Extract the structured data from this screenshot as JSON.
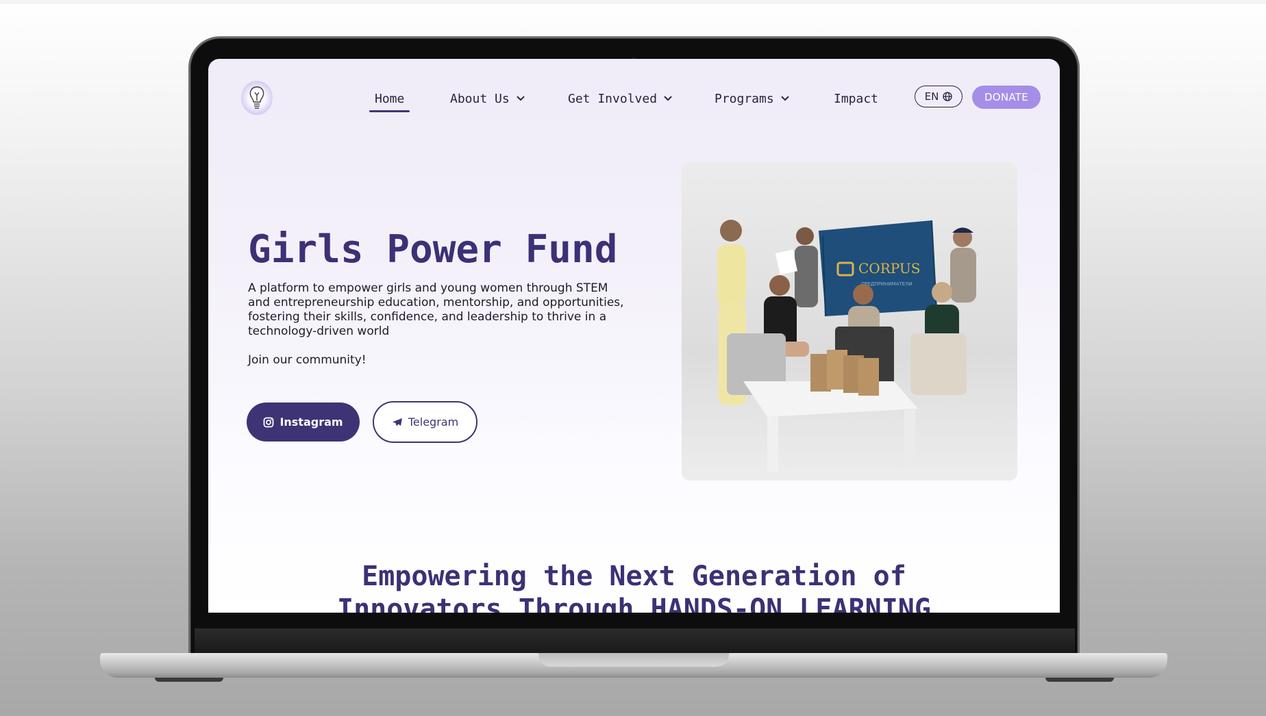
{
  "nav": {
    "items": [
      {
        "label": "Home",
        "has_dropdown": false,
        "active": true
      },
      {
        "label": "About Us",
        "has_dropdown": true
      },
      {
        "label": "Get Involved",
        "has_dropdown": true
      },
      {
        "label": "Programs",
        "has_dropdown": true
      },
      {
        "label": "Impact",
        "has_dropdown": false
      }
    ],
    "language": "EN",
    "donate_label": "DONATE"
  },
  "hero": {
    "title": "Girls Power Fund",
    "description": "A platform to empower girls and young women through STEM and entrepreneurship education, mentorship, and opportunities, fostering their skills, confidence, and leadership to thrive in a technology-driven world",
    "join": "Join our community!",
    "instagram_label": "Instagram",
    "telegram_label": "Telegram"
  },
  "photo": {
    "banner_text": "CORPUS",
    "banner_subtext": "ПРЕДПРИНИМАТЕЛИ"
  },
  "section": {
    "title_line1": "Empowering the Next Generation of",
    "title_line2": "Innovators Through HANDS-ON LEARNING"
  },
  "colors": {
    "primary": "#3e3475",
    "accent": "#a48ee8",
    "background": "#f0ecf8"
  }
}
